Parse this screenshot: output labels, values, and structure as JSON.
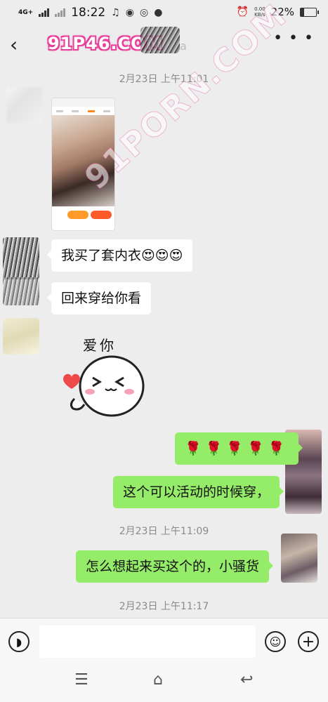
{
  "status_bar": {
    "network": "4G+",
    "time": "18:22",
    "speed_value": "0.00",
    "speed_unit": "KB/s",
    "battery": "22%",
    "battery_level": 0.22
  },
  "header": {
    "back_icon": "chevron-left-icon",
    "title_watermark": "91P46.COM",
    "title_fragment": "a",
    "more_icon": "more-dots-icon"
  },
  "watermark_overlay": "91PORN.COM",
  "messages": {
    "ts1": "2月23日 上午11:01",
    "msg1": "我买了套内衣😍😍😍",
    "msg2": "回来穿给你看",
    "sticker_text": "爱你",
    "msg3_roses": "🌹🌹🌹🌹🌹",
    "msg4": "这个可以活动的时候穿，",
    "ts2": "2月23日 上午11:09",
    "msg5": "怎么想起来买这个的，小骚货",
    "ts3": "2月23日 上午11:17"
  },
  "input_bar": {
    "voice_icon": "voice-icon",
    "emoji_icon": "emoji-icon",
    "plus_icon": "plus-icon",
    "input_value": ""
  },
  "nav_bar": {
    "menu_icon": "menu-icon",
    "home_icon": "home-icon",
    "back_icon": "back-icon"
  }
}
